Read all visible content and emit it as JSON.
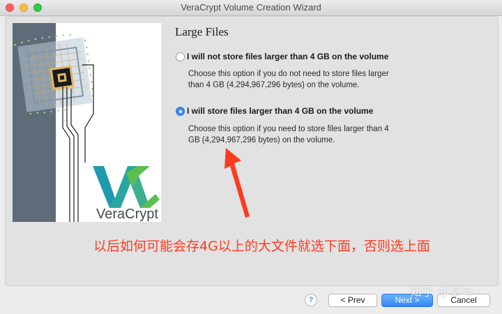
{
  "window": {
    "title": "VeraCrypt Volume Creation Wizard"
  },
  "page": {
    "heading": "Large Files"
  },
  "options": [
    {
      "label": "I will not store files larger than 4 GB on the volume",
      "description_line1": "Choose this option if you do not need to store files larger",
      "description_line2": "than 4 GB (4,294,967,296 bytes) on the volume.",
      "selected": false
    },
    {
      "label": "I will store files larger than 4 GB on the volume",
      "description_line1": "Choose this option if you need to store files larger than 4",
      "description_line2": "GB (4,294,967,296 bytes) on the volume.",
      "selected": true
    }
  ],
  "branding": {
    "logo_text": "VeraCrypt"
  },
  "annotation": {
    "text": "以后如何可能会存4G以上的大文件就选下面，否则选上面",
    "color": "#ff3b20"
  },
  "buttons": {
    "help": "?",
    "prev": "< Prev",
    "next": "Next >",
    "cancel": "Cancel"
  },
  "watermark": {
    "text": "知乎 @意与"
  },
  "colors": {
    "accent": "#3b8df3",
    "annotation": "#ff3b20",
    "logo_teal": "#1f9bb0",
    "logo_green": "#5bbf4e"
  }
}
